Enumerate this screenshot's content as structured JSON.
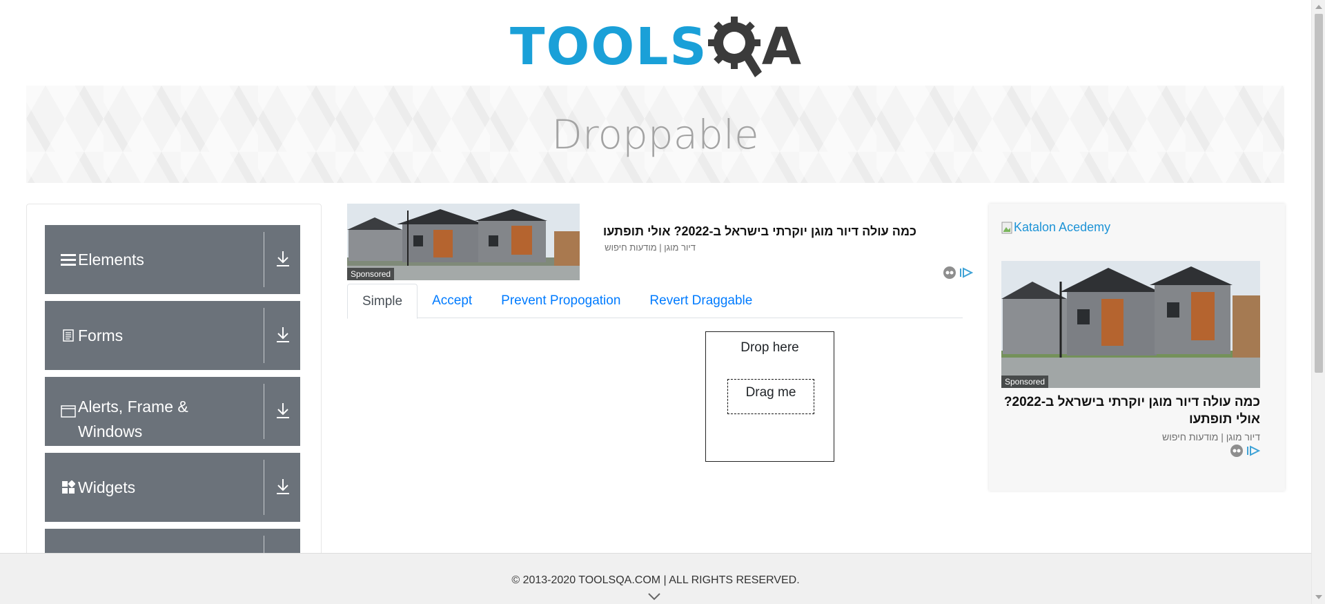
{
  "header": {
    "logo_text_tools": "TOOLS",
    "logo_text_qa": "QA"
  },
  "banner": {
    "title": "Droppable"
  },
  "sidebar": {
    "groups": [
      {
        "label": "Elements",
        "icon": "hamburger-icon"
      },
      {
        "label": "Forms",
        "icon": "document-icon"
      },
      {
        "label": "Alerts, Frame & Windows",
        "icon": "window-icon"
      },
      {
        "label": "Widgets",
        "icon": "widgets-icon"
      },
      {
        "label": "",
        "icon": ""
      }
    ],
    "group_bg": "#6b727a"
  },
  "ad_top": {
    "headline": "כמה עולה דיור מוגן יוקרתי בישראל ב-2022? אולי תופתעו",
    "source": "דיור מוגן | מודעות חיפוש",
    "sponsored": "Sponsored"
  },
  "tabs": [
    {
      "label": "Simple",
      "active": true
    },
    {
      "label": "Accept",
      "active": false
    },
    {
      "label": "Prevent Propogation",
      "active": false
    },
    {
      "label": "Revert Draggable",
      "active": false
    }
  ],
  "droppable": {
    "drop_label": "Drop here",
    "drag_label": "Drag me"
  },
  "ad_right": {
    "broken_image_alt": "Katalon Acedemy",
    "sponsored": "Sponsored",
    "headline": "כמה עולה דיור מוגן יוקרתי בישראל ב-2022? אולי תופתעו",
    "source": "דיור מוגן | מודעות חיפוש"
  },
  "footer": {
    "text": "© 2013-2020 TOOLSQA.COM | ALL RIGHTS RESERVED."
  },
  "colors": {
    "accent": "#1aa0d8",
    "link": "#007bff",
    "logo_dark": "#3b3b3b"
  }
}
